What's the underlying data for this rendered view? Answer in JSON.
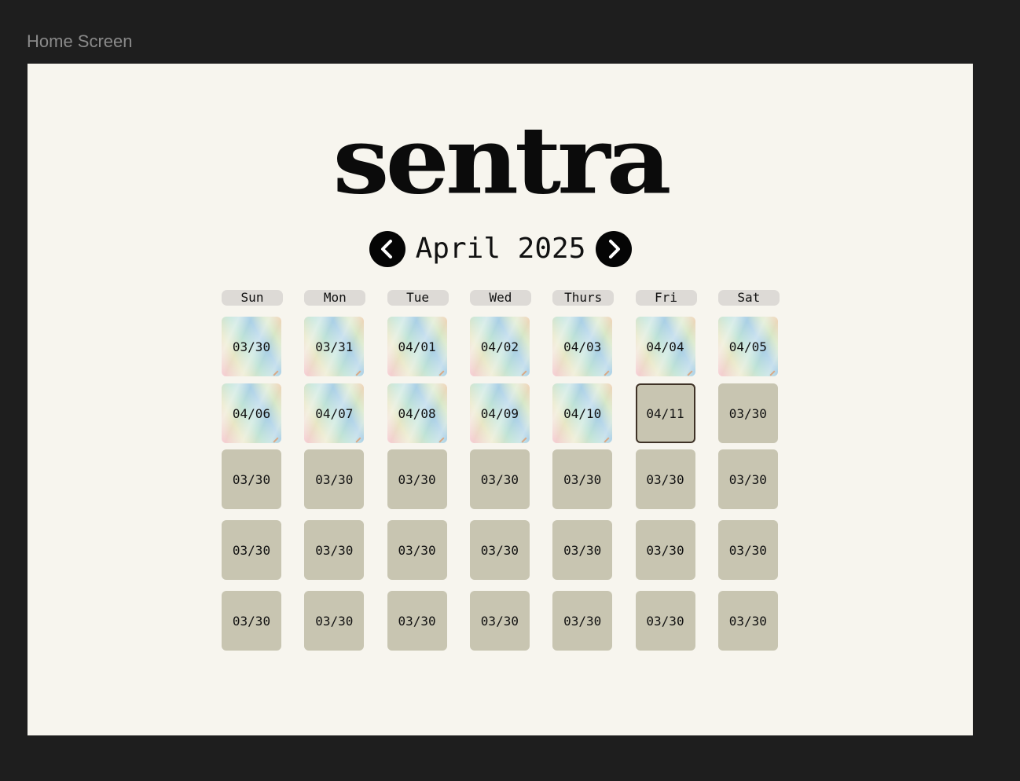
{
  "frame_label": "Home Screen",
  "app": {
    "logo_text": "sentra"
  },
  "calendar": {
    "month_title": "April 2025",
    "weekdays": [
      "Sun",
      "Mon",
      "Tue",
      "Wed",
      "Thurs",
      "Fri",
      "Sat"
    ],
    "weeks": [
      [
        {
          "label": "03/30",
          "state": "textured"
        },
        {
          "label": "03/31",
          "state": "textured"
        },
        {
          "label": "04/01",
          "state": "textured"
        },
        {
          "label": "04/02",
          "state": "textured"
        },
        {
          "label": "04/03",
          "state": "textured"
        },
        {
          "label": "04/04",
          "state": "textured"
        },
        {
          "label": "04/05",
          "state": "textured"
        }
      ],
      [
        {
          "label": "04/06",
          "state": "textured"
        },
        {
          "label": "04/07",
          "state": "textured"
        },
        {
          "label": "04/08",
          "state": "textured"
        },
        {
          "label": "04/09",
          "state": "textured"
        },
        {
          "label": "04/10",
          "state": "textured"
        },
        {
          "label": "04/11",
          "state": "selected"
        },
        {
          "label": "03/30",
          "state": "empty"
        }
      ],
      [
        {
          "label": "03/30",
          "state": "empty"
        },
        {
          "label": "03/30",
          "state": "empty"
        },
        {
          "label": "03/30",
          "state": "empty"
        },
        {
          "label": "03/30",
          "state": "empty"
        },
        {
          "label": "03/30",
          "state": "empty"
        },
        {
          "label": "03/30",
          "state": "empty"
        },
        {
          "label": "03/30",
          "state": "empty"
        }
      ],
      [
        {
          "label": "03/30",
          "state": "empty"
        },
        {
          "label": "03/30",
          "state": "empty"
        },
        {
          "label": "03/30",
          "state": "empty"
        },
        {
          "label": "03/30",
          "state": "empty"
        },
        {
          "label": "03/30",
          "state": "empty"
        },
        {
          "label": "03/30",
          "state": "empty"
        },
        {
          "label": "03/30",
          "state": "empty"
        }
      ],
      [
        {
          "label": "03/30",
          "state": "empty"
        },
        {
          "label": "03/30",
          "state": "empty"
        },
        {
          "label": "03/30",
          "state": "empty"
        },
        {
          "label": "03/30",
          "state": "empty"
        },
        {
          "label": "03/30",
          "state": "empty"
        },
        {
          "label": "03/30",
          "state": "empty"
        },
        {
          "label": "03/30",
          "state": "empty"
        }
      ]
    ]
  },
  "icons": {
    "prev": "chevron-left-icon",
    "next": "chevron-right-icon"
  },
  "colors": {
    "background": "#1e1e1e",
    "frame": "#f7f5ee",
    "empty_day": "#c8c5b1",
    "weekday_pill": "#dddad6",
    "selected_border": "#3f3226",
    "nav_button": "#050505"
  }
}
